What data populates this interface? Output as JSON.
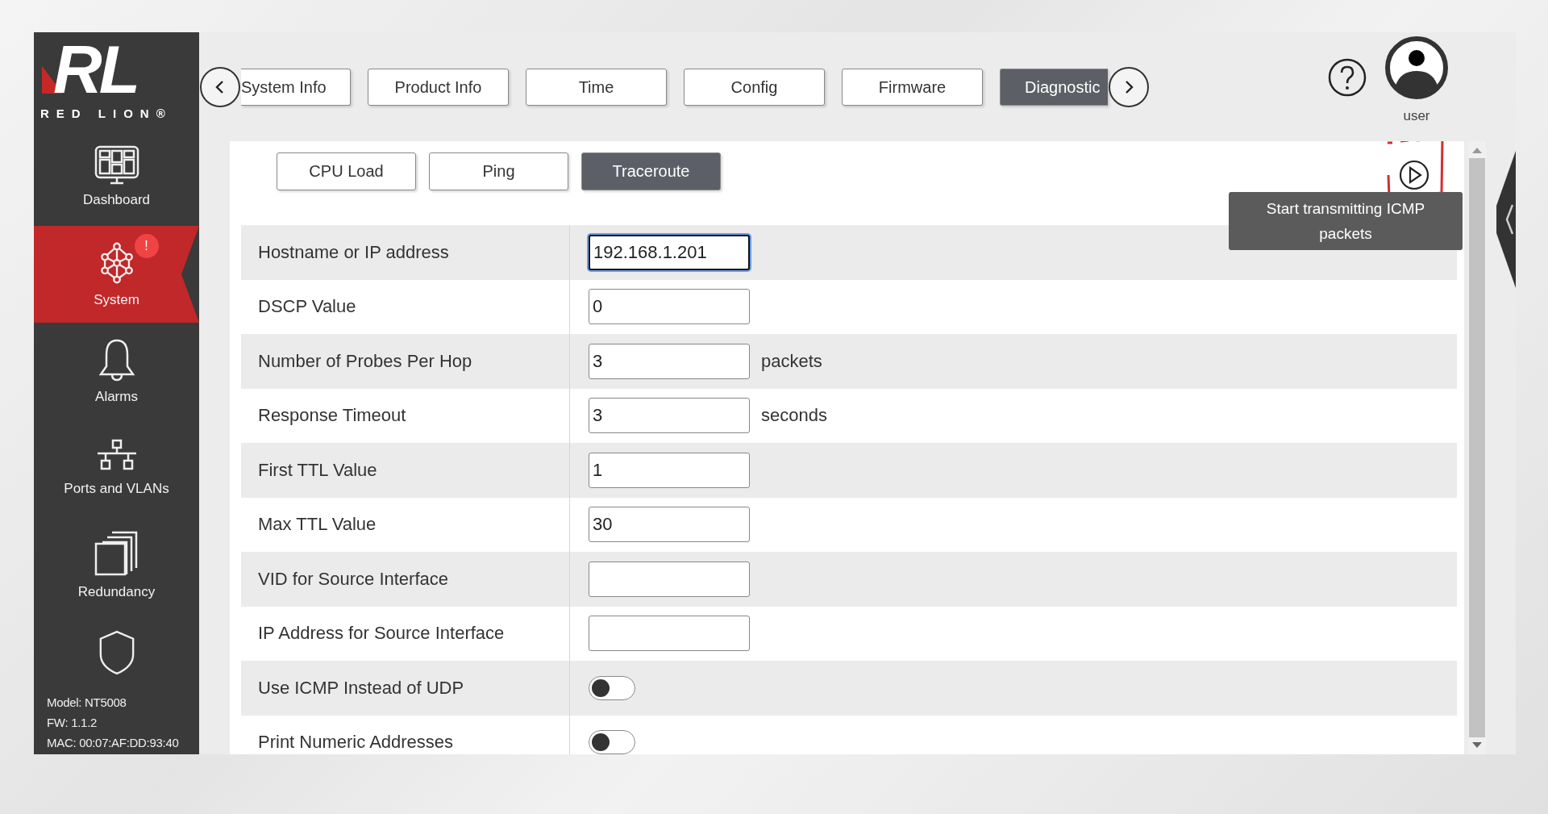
{
  "logo": {
    "mark": "RL",
    "name": "RED LION®"
  },
  "sidebar": {
    "items": [
      {
        "label": "Dashboard",
        "selected": false
      },
      {
        "label": "System",
        "selected": true,
        "badge": "!"
      },
      {
        "label": "Alarms",
        "selected": false
      },
      {
        "label": "Ports and VLANs",
        "selected": false
      },
      {
        "label": "Redundancy",
        "selected": false
      },
      {
        "selected": false
      }
    ],
    "device_info": [
      "Model: NT5008",
      "FW: 1.1.2",
      "MAC: 00:07:AF:DD:93:40"
    ]
  },
  "tabs": [
    {
      "label": "System Info",
      "selected": false
    },
    {
      "label": "Product Info",
      "selected": false
    },
    {
      "label": "Time",
      "selected": false
    },
    {
      "label": "Config",
      "selected": false
    },
    {
      "label": "Firmware",
      "selected": false
    },
    {
      "label": "Diagnostic",
      "selected": true
    }
  ],
  "user": {
    "name": "user"
  },
  "subtabs": [
    {
      "label": "CPU Load",
      "selected": false
    },
    {
      "label": "Ping",
      "selected": false
    },
    {
      "label": "Traceroute",
      "selected": true
    }
  ],
  "tooltip": {
    "text": "Start transmitting ICMP packets"
  },
  "fields": [
    {
      "kind": "text",
      "label": "Hostname or IP address",
      "value": "192.168.1.201",
      "focused": true
    },
    {
      "kind": "text",
      "label": "DSCP Value",
      "value": "0",
      "focused": false
    },
    {
      "kind": "text",
      "label": "Number of Probes Per Hop",
      "value": "3",
      "unit": "packets",
      "focused": false
    },
    {
      "kind": "text",
      "label": "Response Timeout",
      "value": "3",
      "unit": "seconds",
      "focused": false
    },
    {
      "kind": "text",
      "label": "First TTL Value",
      "value": "1",
      "focused": false
    },
    {
      "kind": "text",
      "label": "Max TTL Value",
      "value": "30",
      "focused": false
    },
    {
      "kind": "text",
      "label": "VID for Source Interface",
      "focused": false
    },
    {
      "kind": "text",
      "label": "IP Address for Source Interface",
      "focused": false
    },
    {
      "kind": "toggle",
      "label": "Use ICMP Instead of UDP",
      "on": false
    },
    {
      "kind": "toggle",
      "label": "Print Numeric Addresses",
      "on": false
    }
  ]
}
